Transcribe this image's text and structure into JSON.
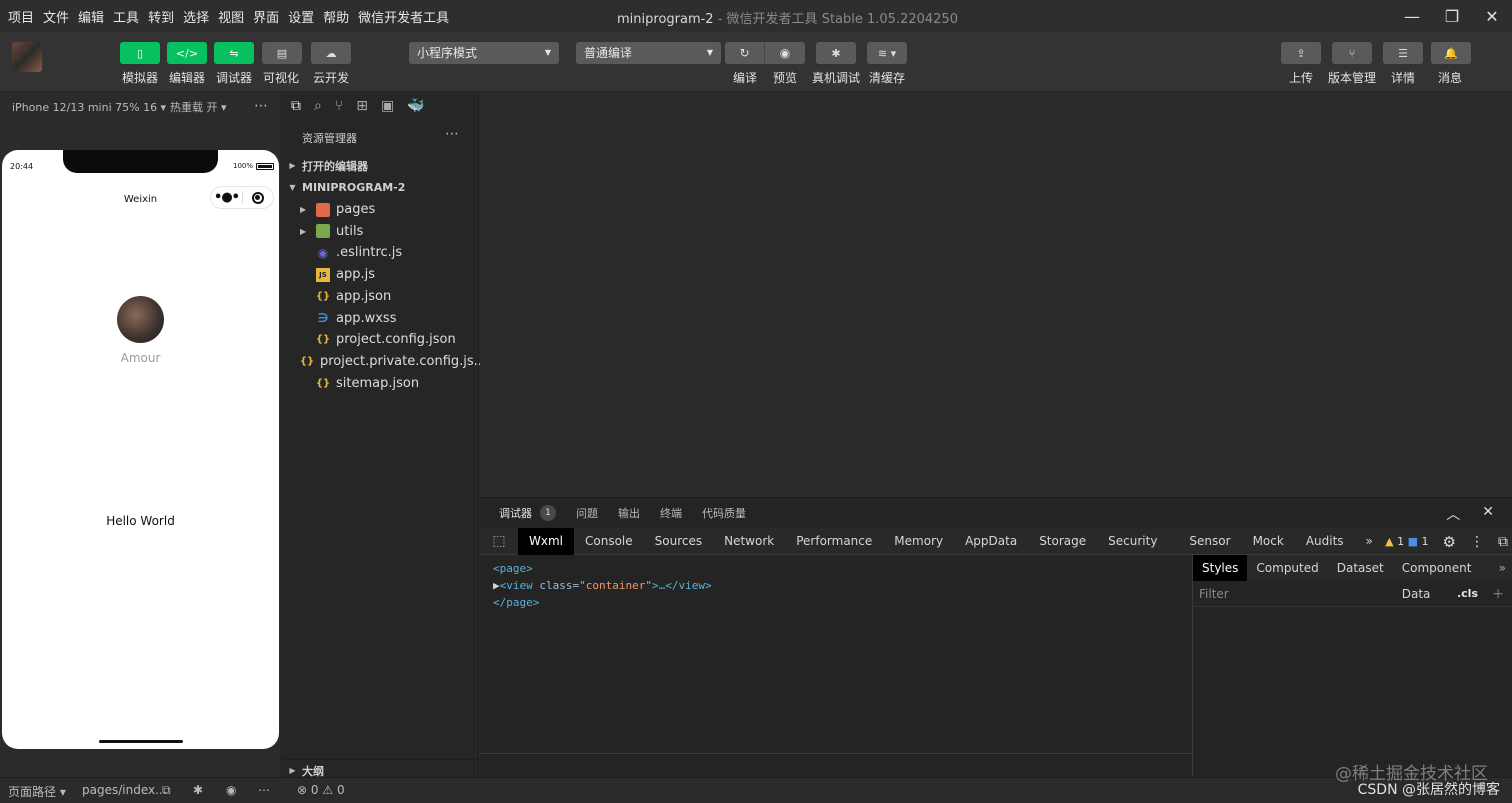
{
  "menu": [
    "项目",
    "文件",
    "编辑",
    "工具",
    "转到",
    "选择",
    "视图",
    "界面",
    "设置",
    "帮助",
    "微信开发者工具"
  ],
  "window": {
    "title": "miniprogram-2",
    "subtitle": "- 微信开发者工具 Stable 1.05.2204250"
  },
  "toolbar": {
    "simulator": "模拟器",
    "editor": "编辑器",
    "debugger": "调试器",
    "visual": "可视化",
    "cloud": "云开发",
    "mode_select": "小程序模式",
    "compile_select": "普通编译",
    "compile": "编译",
    "preview": "预览",
    "real_debug": "真机调试",
    "clear_cache": "清缓存",
    "upload": "上传",
    "version": "版本管理",
    "details": "详情",
    "messages": "消息"
  },
  "simulator": {
    "device": "iPhone 12/13 mini 75% 16 ▾",
    "hot_reload": "热重载 开 ▾",
    "time": "20:44",
    "battery": "100%",
    "nav_title": "Weixin",
    "user_name": "Amour",
    "hello": "Hello World"
  },
  "explorer": {
    "title": "资源管理器",
    "open_editors": "打开的编辑器",
    "project": "MINIPROGRAM-2",
    "outline": "大纲",
    "files": [
      {
        "name": "pages",
        "type": "folder-pages",
        "arrow": "▶"
      },
      {
        "name": "utils",
        "type": "folder-utils",
        "arrow": "▶"
      },
      {
        "name": ".eslintrc.js",
        "type": "eslint",
        "arrow": ""
      },
      {
        "name": "app.js",
        "type": "js",
        "arrow": ""
      },
      {
        "name": "app.json",
        "type": "json",
        "arrow": ""
      },
      {
        "name": "app.wxss",
        "type": "css",
        "arrow": ""
      },
      {
        "name": "project.config.json",
        "type": "json",
        "arrow": ""
      },
      {
        "name": "project.private.config.js...",
        "type": "json",
        "arrow": ""
      },
      {
        "name": "sitemap.json",
        "type": "json",
        "arrow": ""
      }
    ]
  },
  "debugger": {
    "tabs": {
      "debugger": "调试器",
      "badge": "1",
      "issues": "问题",
      "output": "输出",
      "terminal": "终端",
      "quality": "代码质量"
    },
    "devtools_tabs": [
      "Wxml",
      "Console",
      "Sources",
      "Network",
      "Performance",
      "Memory",
      "AppData",
      "Storage",
      "Security",
      "Sensor",
      "Mock",
      "Audits"
    ],
    "overflow": "»",
    "warnings": "1",
    "messages": "1",
    "wxml": {
      "line1": "<page>",
      "open": "<view ",
      "attr": "class=",
      "val": "\"container\"",
      "rest": ">…</view>",
      "line3": "</page>"
    },
    "styles_tabs": [
      "Styles",
      "Computed",
      "Dataset",
      "Component Data"
    ],
    "filter_placeholder": "Filter",
    "cls": ".cls"
  },
  "statusbar": {
    "page_path": "页面路径 ▾",
    "path": "pages/index...",
    "errors": "0",
    "warnings": "0"
  },
  "watermark": {
    "line1": "@稀土掘金技术社区",
    "line2": "CSDN @张居然的博客"
  }
}
